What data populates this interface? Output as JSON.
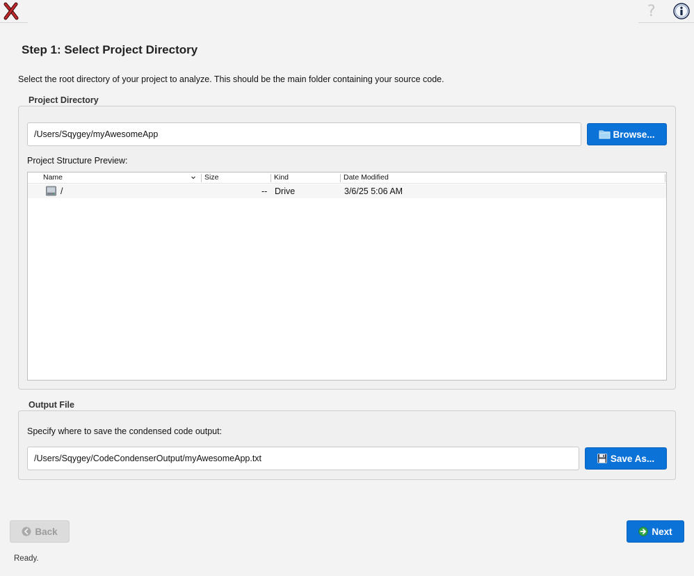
{
  "header": {
    "help_glyph": "?"
  },
  "step": {
    "title": "Step 1: Select Project Directory",
    "description": "Select the root directory of your project to analyze. This should be the main folder containing your source code."
  },
  "project_directory": {
    "group_label": "Project Directory",
    "path_value": "/Users/Sqygey/myAwesomeApp",
    "browse_label": "Browse...",
    "preview_label": "Project Structure Preview:",
    "columns": [
      "Name",
      "Size",
      "Kind",
      "Date Modified"
    ],
    "rows": [
      {
        "name": "/",
        "size": "--",
        "kind": "Drive",
        "date_modified": "3/6/25 5:06 AM"
      }
    ]
  },
  "output_file": {
    "group_label": "Output File",
    "instruction": "Specify where to save the condensed code output:",
    "path_value": "/Users/Sqygey/CodeCondenserOutput/myAwesomeApp.txt",
    "save_as_label": "Save As..."
  },
  "navigation": {
    "back_label": "Back",
    "next_label": "Next"
  },
  "status": {
    "text": "Ready."
  },
  "colors": {
    "primary_button": "#0b72d8",
    "window_background": "#f3f3f3",
    "disabled_button": "#dcdcdc"
  },
  "icons": [
    "close-x-icon",
    "help-icon",
    "info-icon",
    "folder-icon",
    "drive-icon",
    "floppy-disk-icon",
    "back-arrow-icon",
    "next-arrow-icon",
    "sort-chevron-icon"
  ]
}
